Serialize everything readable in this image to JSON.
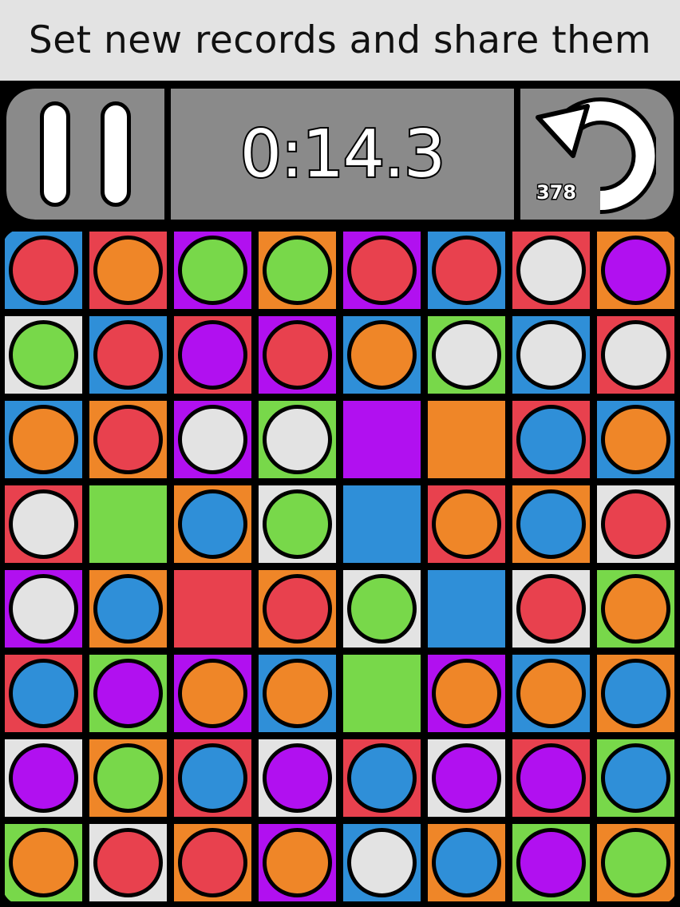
{
  "banner": {
    "text": "Set new records and share them"
  },
  "hud": {
    "timer": "0:14.3",
    "undo_count": "378",
    "pause_icon": "pause-icon",
    "undo_icon": "undo-arrow-icon",
    "panel_color": "#8a8a8a"
  },
  "palette": {
    "B": "#2f8fd8",
    "R": "#e8414e",
    "P": "#b110f0",
    "O": "#ef8628",
    "W": "#e3e3e3",
    "G": "#78d84a"
  },
  "board": {
    "rows": 8,
    "cols": 8,
    "cells": [
      [
        {
          "bg": "B",
          "orb": "R"
        },
        {
          "bg": "R",
          "orb": "O"
        },
        {
          "bg": "P",
          "orb": "G"
        },
        {
          "bg": "O",
          "orb": "G"
        },
        {
          "bg": "P",
          "orb": "R"
        },
        {
          "bg": "B",
          "orb": "R"
        },
        {
          "bg": "R",
          "orb": "W"
        },
        {
          "bg": "O",
          "orb": "P"
        }
      ],
      [
        {
          "bg": "W",
          "orb": "G"
        },
        {
          "bg": "B",
          "orb": "R"
        },
        {
          "bg": "R",
          "orb": "P"
        },
        {
          "bg": "P",
          "orb": "R"
        },
        {
          "bg": "B",
          "orb": "O"
        },
        {
          "bg": "G",
          "orb": "W"
        },
        {
          "bg": "B",
          "orb": "W"
        },
        {
          "bg": "R",
          "orb": "W"
        }
      ],
      [
        {
          "bg": "B",
          "orb": "O"
        },
        {
          "bg": "O",
          "orb": "R"
        },
        {
          "bg": "P",
          "orb": "W"
        },
        {
          "bg": "G",
          "orb": "W"
        },
        {
          "bg": "P",
          "orb": null
        },
        {
          "bg": "O",
          "orb": null
        },
        {
          "bg": "R",
          "orb": "B"
        },
        {
          "bg": "B",
          "orb": "O"
        }
      ],
      [
        {
          "bg": "R",
          "orb": "W"
        },
        {
          "bg": "G",
          "orb": null
        },
        {
          "bg": "O",
          "orb": "B"
        },
        {
          "bg": "W",
          "orb": "G"
        },
        {
          "bg": "B",
          "orb": null
        },
        {
          "bg": "R",
          "orb": "O"
        },
        {
          "bg": "O",
          "orb": "B"
        },
        {
          "bg": "W",
          "orb": "R"
        }
      ],
      [
        {
          "bg": "P",
          "orb": "W"
        },
        {
          "bg": "O",
          "orb": "B"
        },
        {
          "bg": "R",
          "orb": null
        },
        {
          "bg": "O",
          "orb": "R"
        },
        {
          "bg": "W",
          "orb": "G"
        },
        {
          "bg": "B",
          "orb": null
        },
        {
          "bg": "W",
          "orb": "R"
        },
        {
          "bg": "G",
          "orb": "O"
        }
      ],
      [
        {
          "bg": "R",
          "orb": "B"
        },
        {
          "bg": "G",
          "orb": "P"
        },
        {
          "bg": "P",
          "orb": "O"
        },
        {
          "bg": "B",
          "orb": "O"
        },
        {
          "bg": "G",
          "orb": null
        },
        {
          "bg": "P",
          "orb": "O"
        },
        {
          "bg": "B",
          "orb": "O"
        },
        {
          "bg": "O",
          "orb": "B"
        }
      ],
      [
        {
          "bg": "W",
          "orb": "P"
        },
        {
          "bg": "O",
          "orb": "G"
        },
        {
          "bg": "R",
          "orb": "B"
        },
        {
          "bg": "W",
          "orb": "P"
        },
        {
          "bg": "R",
          "orb": "B"
        },
        {
          "bg": "W",
          "orb": "P"
        },
        {
          "bg": "R",
          "orb": "P"
        },
        {
          "bg": "G",
          "orb": "B"
        }
      ],
      [
        {
          "bg": "G",
          "orb": "O"
        },
        {
          "bg": "W",
          "orb": "R"
        },
        {
          "bg": "O",
          "orb": "R"
        },
        {
          "bg": "P",
          "orb": "O"
        },
        {
          "bg": "B",
          "orb": "W"
        },
        {
          "bg": "O",
          "orb": "B"
        },
        {
          "bg": "G",
          "orb": "P"
        },
        {
          "bg": "O",
          "orb": "G"
        }
      ]
    ]
  }
}
